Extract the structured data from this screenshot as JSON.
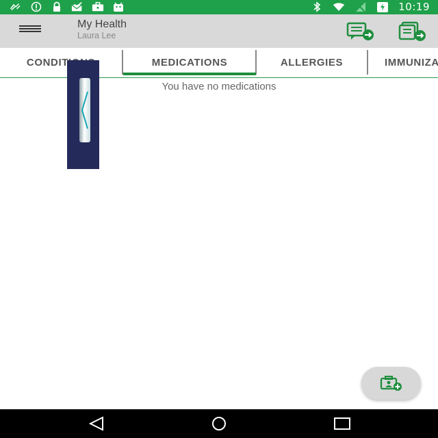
{
  "status_bar": {
    "time": "10:19",
    "left_icons": [
      "satellite-icon",
      "info-circle-icon",
      "lock-icon",
      "envelope-check-icon",
      "briefcase-icon",
      "android-icon"
    ],
    "right_icons": [
      "bluetooth-icon",
      "wifi-icon",
      "no-signal-icon",
      "battery-charging-icon"
    ]
  },
  "app_bar": {
    "title": "My Health",
    "subtitle": "Laura Lee",
    "actions": [
      "message-forward-icon",
      "document-forward-icon"
    ]
  },
  "tabs": [
    {
      "label": "CONDITIONS",
      "active": false
    },
    {
      "label": "MEDICATIONS",
      "active": true
    },
    {
      "label": "ALLERGIES",
      "active": false
    },
    {
      "label": "IMMUNIZATIONS",
      "active": false
    }
  ],
  "content": {
    "empty_message": "You have no medications"
  },
  "fab": {
    "icon": "add-medical-card-icon"
  },
  "nav_bar": {
    "buttons": [
      "back-icon",
      "home-icon",
      "recents-icon"
    ]
  },
  "colors": {
    "status_bar": "#1fa04a",
    "accent": "#1e8e3e",
    "app_bar": "#d9d9d9"
  }
}
